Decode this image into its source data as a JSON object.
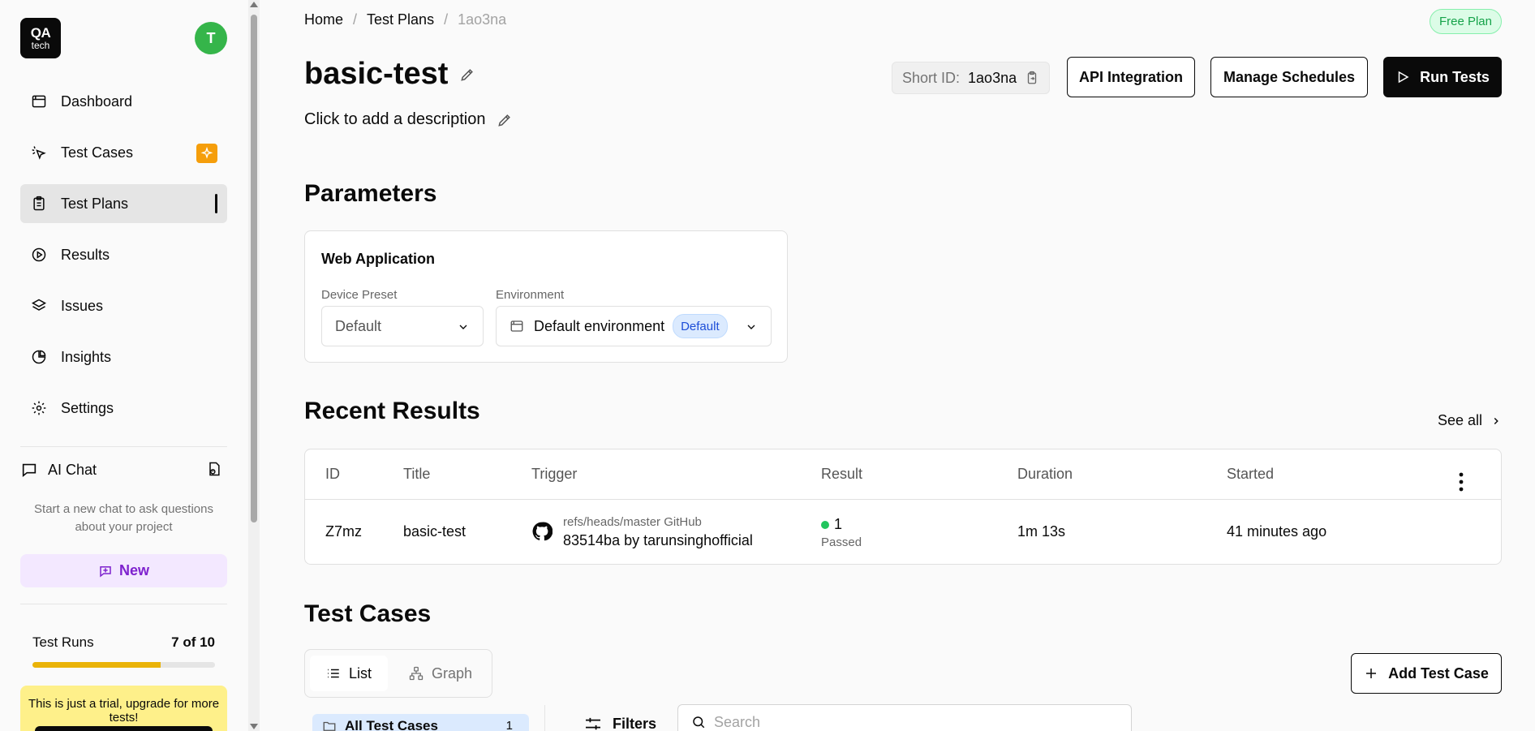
{
  "app": {
    "logo_top": "QA",
    "logo_bottom": "tech",
    "avatar_initial": "T"
  },
  "sidebar": {
    "items": [
      {
        "label": "Dashboard",
        "icon": "calendar-icon"
      },
      {
        "label": "Test Cases",
        "icon": "cursor-click-icon"
      },
      {
        "label": "Test Plans",
        "icon": "clipboard-icon"
      },
      {
        "label": "Results",
        "icon": "play-circle-icon"
      },
      {
        "label": "Issues",
        "icon": "layers-icon"
      },
      {
        "label": "Insights",
        "icon": "pie-chart-icon"
      },
      {
        "label": "Settings",
        "icon": "gear-icon"
      }
    ],
    "ai_chat_label": "AI Chat",
    "ai_hint": "Start a new chat to ask questions about your project",
    "new_label": "New",
    "test_runs_label": "Test Runs",
    "test_runs_value": "7 of 10",
    "test_runs_fraction": 0.7,
    "trial_text": "This is just a trial, upgrade for more tests!"
  },
  "breadcrumb": [
    "Home",
    "Test Plans",
    "1ao3na"
  ],
  "plan_badge": "Free Plan",
  "page": {
    "title": "basic-test",
    "description": "Click to add a description",
    "short_id_label": "Short ID:",
    "short_id": "1ao3na",
    "api_integration": "API Integration",
    "manage_schedules": "Manage Schedules",
    "run_tests": "Run Tests"
  },
  "parameters": {
    "heading": "Parameters",
    "card_title": "Web Application",
    "device_label": "Device Preset",
    "device_value": "Default",
    "env_label": "Environment",
    "env_value": "Default environment",
    "env_badge": "Default"
  },
  "recent": {
    "heading": "Recent Results",
    "see_all": "See all",
    "columns": [
      "ID",
      "Title",
      "Trigger",
      "Result",
      "Duration",
      "Started"
    ],
    "rows": [
      {
        "id": "Z7mz",
        "title": "basic-test",
        "trigger_top": "refs/heads/master GitHub",
        "trigger_bottom": "83514ba by tarunsinghofficial",
        "result_count": "1",
        "result_label": "Passed",
        "duration": "1m 13s",
        "started": "41 minutes ago"
      }
    ]
  },
  "test_cases": {
    "heading": "Test Cases",
    "tab_list": "List",
    "tab_graph": "Graph",
    "add_label": "Add Test Case",
    "folder_label": "All Test Cases",
    "folder_count": "1",
    "filters_label": "Filters",
    "search_placeholder": "Search"
  },
  "colors": {
    "accent": "#0a0a0a",
    "free_plan": "#16a34a",
    "ai_new": "#7e22ce",
    "passed": "#22c55e",
    "progress": "#eab308"
  }
}
